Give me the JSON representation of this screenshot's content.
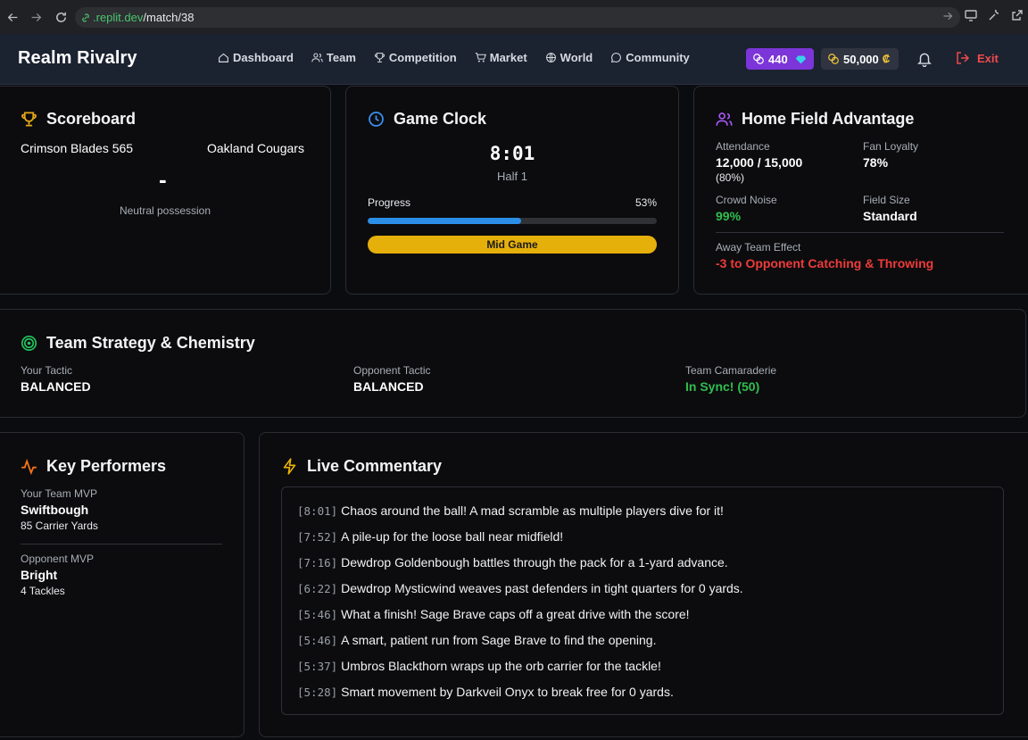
{
  "browser": {
    "url_host": ".replit.dev",
    "url_path": "/match/38"
  },
  "header": {
    "brand": "Realm Rivalry",
    "nav": [
      {
        "label": "Dashboard",
        "icon": "home-icon"
      },
      {
        "label": "Team",
        "icon": "users-icon"
      },
      {
        "label": "Competition",
        "icon": "trophy-icon"
      },
      {
        "label": "Market",
        "icon": "cart-icon"
      },
      {
        "label": "World",
        "icon": "globe-icon"
      },
      {
        "label": "Community",
        "icon": "chat-icon"
      }
    ],
    "gems": "440",
    "coins": "50,000",
    "exit_label": "Exit",
    "colors": {
      "gems_bg": "#7b35d8",
      "exit": "#f04b4b"
    }
  },
  "scoreboard": {
    "title": "Scoreboard",
    "home_team": "Crimson Blades 565",
    "away_team": "Oakland Cougars",
    "score_sep": "-",
    "possession": "Neutral possession"
  },
  "clock": {
    "title": "Game Clock",
    "time": "8:01",
    "half": "Half 1",
    "progress_label": "Progress",
    "progress_text": "53%",
    "progress": 0.53,
    "phase": "Mid Game"
  },
  "home_field": {
    "title": "Home Field Advantage",
    "attendance_label": "Attendance",
    "attendance_value": "12,000 / 15,000",
    "attendance_pct": "(80%)",
    "fan_loyalty_label": "Fan Loyalty",
    "fan_loyalty_value": "78%",
    "crowd_noise_label": "Crowd Noise",
    "crowd_noise_value": "99%",
    "field_size_label": "Field Size",
    "field_size_value": "Standard",
    "away_effect_label": "Away Team Effect",
    "away_effect_value": "-3 to Opponent Catching & Throwing"
  },
  "strategy": {
    "title": "Team Strategy & Chemistry",
    "your_tactic_label": "Your Tactic",
    "your_tactic_value": "BALANCED",
    "opp_tactic_label": "Opponent Tactic",
    "opp_tactic_value": "BALANCED",
    "camaraderie_label": "Team Camaraderie",
    "camaraderie_value": "In Sync! (50)"
  },
  "performers": {
    "title": "Key Performers",
    "your_mvp_label": "Your Team MVP",
    "your_mvp_name": "Swiftbough",
    "your_mvp_stat": "85 Carrier Yards",
    "opp_mvp_label": "Opponent MVP",
    "opp_mvp_name": "Bright",
    "opp_mvp_stat": "4 Tackles"
  },
  "commentary": {
    "title": "Live Commentary",
    "entries": [
      {
        "time": "[8:01]",
        "text": "Chaos around the ball! A mad scramble as multiple players dive for it!"
      },
      {
        "time": "[7:52]",
        "text": "A pile-up for the loose ball near midfield!"
      },
      {
        "time": "[7:16]",
        "text": "Dewdrop Goldenbough battles through the pack for a 1-yard advance."
      },
      {
        "time": "[6:22]",
        "text": "Dewdrop Mysticwind weaves past defenders in tight quarters for 0 yards."
      },
      {
        "time": "[5:46]",
        "text": "What a finish! Sage Brave caps off a great drive with the score!"
      },
      {
        "time": "[5:46]",
        "text": "A smart, patient run from Sage Brave to find the opening."
      },
      {
        "time": "[5:37]",
        "text": "Umbros Blackthorn wraps up the orb carrier for the tackle!"
      },
      {
        "time": "[5:28]",
        "text": "Smart movement by Darkveil Onyx to break free for 0 yards."
      }
    ]
  }
}
